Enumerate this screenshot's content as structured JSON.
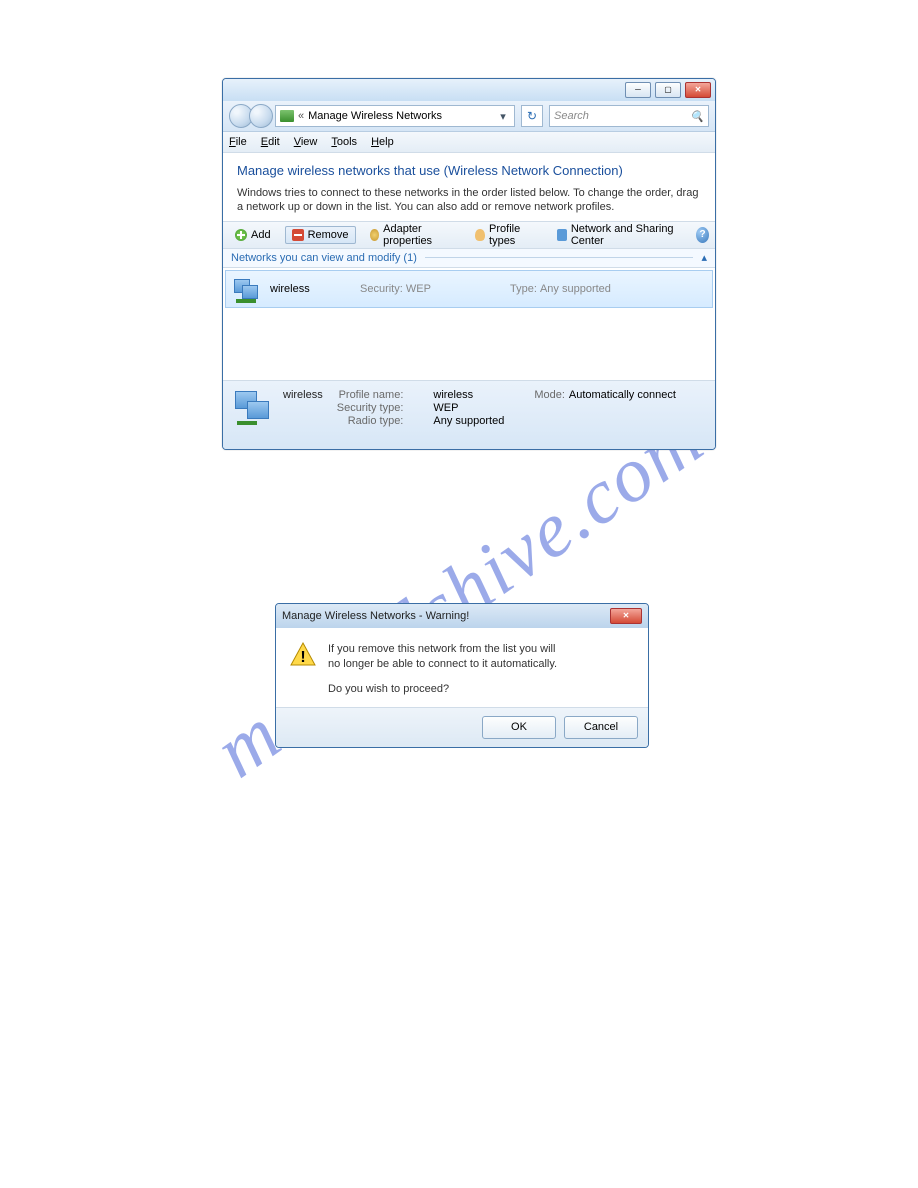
{
  "watermark": "manualshive.com",
  "explorer": {
    "breadcrumb_label": "Manage Wireless Networks",
    "search_placeholder": "Search",
    "menubar": {
      "file": "File",
      "edit": "Edit",
      "view": "View",
      "tools": "Tools",
      "help": "Help"
    },
    "heading": "Manage wireless networks that use (Wireless Network Connection)",
    "description": "Windows tries to connect to these networks in the order listed below. To change the order, drag a network up or down in the list. You can also add or remove network profiles.",
    "toolbar": {
      "add": "Add",
      "remove": "Remove",
      "adapter": "Adapter properties",
      "profile": "Profile types",
      "nsc": "Network and Sharing Center"
    },
    "group_header": "Networks you can view and modify (1)",
    "item": {
      "name": "wireless",
      "security_label": "Security:",
      "security_value": "WEP",
      "type_label": "Type:",
      "type_value": "Any supported"
    },
    "details": {
      "title": "wireless",
      "profile_label": "Profile name:",
      "profile_value": "wireless",
      "sectype_label": "Security type:",
      "sectype_value": "WEP",
      "radio_label": "Radio type:",
      "radio_value": "Any supported",
      "mode_label": "Mode:",
      "mode_value": "Automatically connect"
    }
  },
  "dialog": {
    "title": "Manage Wireless Networks - Warning!",
    "line1": "If you remove this network from the list you will",
    "line2": "no longer be able to connect to it automatically.",
    "line3": "Do you wish to proceed?",
    "ok": "OK",
    "cancel": "Cancel"
  }
}
